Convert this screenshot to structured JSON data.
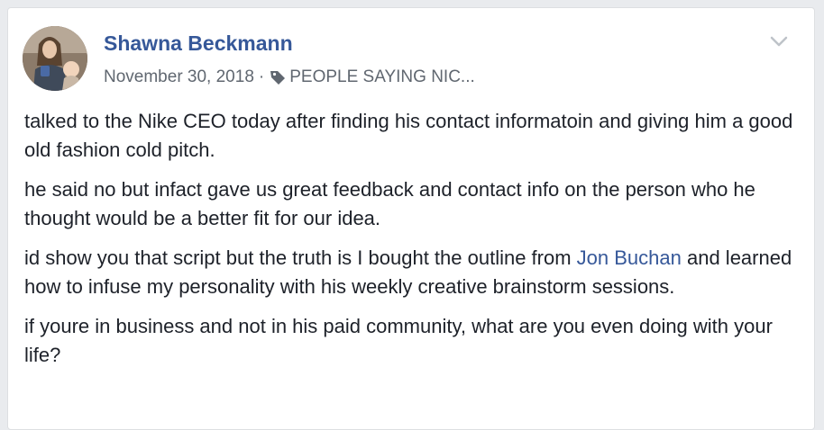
{
  "post": {
    "author": "Shawna Beckmann",
    "date": "November 30, 2018",
    "separator": "·",
    "tag_icon": "tag-icon",
    "tag_label": "PEOPLE SAYING NIC...",
    "menu_icon": "chevron-down-icon",
    "paragraphs": [
      {
        "text": "talked to the Nike CEO today after finding his contact informatoin and giving him a good old fashion cold pitch."
      },
      {
        "text": "he said no but infact gave us great feedback and contact info on the person who he thought would be a better fit for our idea."
      },
      {
        "before": "id show you that script but the truth is I bought the outline from ",
        "mention": "Jon Buchan",
        "after": " and learned how to infuse my personality with his weekly creative brainstorm sessions."
      },
      {
        "text": "if youre in business and not in his paid community, what are you even doing with your life?"
      }
    ]
  },
  "colors": {
    "link": "#365899",
    "meta": "#606770",
    "body_text": "#1d2129"
  }
}
